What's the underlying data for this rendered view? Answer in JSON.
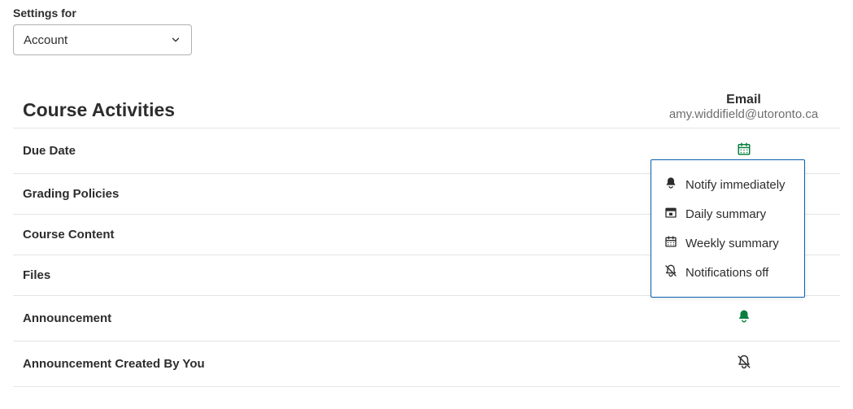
{
  "settings_for_label": "Settings for",
  "account_select": {
    "value": "Account"
  },
  "section_title": "Course Activities",
  "email_header": {
    "title": "Email",
    "address": "amy.widdifield@utoronto.ca"
  },
  "rows": [
    {
      "label": "Due Date",
      "icon": "calendar-week",
      "icon_color": "green"
    },
    {
      "label": "Grading Policies",
      "icon": "none",
      "icon_color": "none"
    },
    {
      "label": "Course Content",
      "icon": "none",
      "icon_color": "none"
    },
    {
      "label": "Files",
      "icon": "none",
      "icon_color": "none"
    },
    {
      "label": "Announcement",
      "icon": "bell",
      "icon_color": "green"
    },
    {
      "label": "Announcement Created By You",
      "icon": "bell-off",
      "icon_color": "dark"
    }
  ],
  "popover": {
    "items": [
      {
        "icon": "bell",
        "label": "Notify immediately"
      },
      {
        "icon": "calendar-day",
        "label": "Daily summary"
      },
      {
        "icon": "calendar-week",
        "label": "Weekly summary"
      },
      {
        "icon": "bell-off",
        "label": "Notifications off"
      }
    ]
  }
}
